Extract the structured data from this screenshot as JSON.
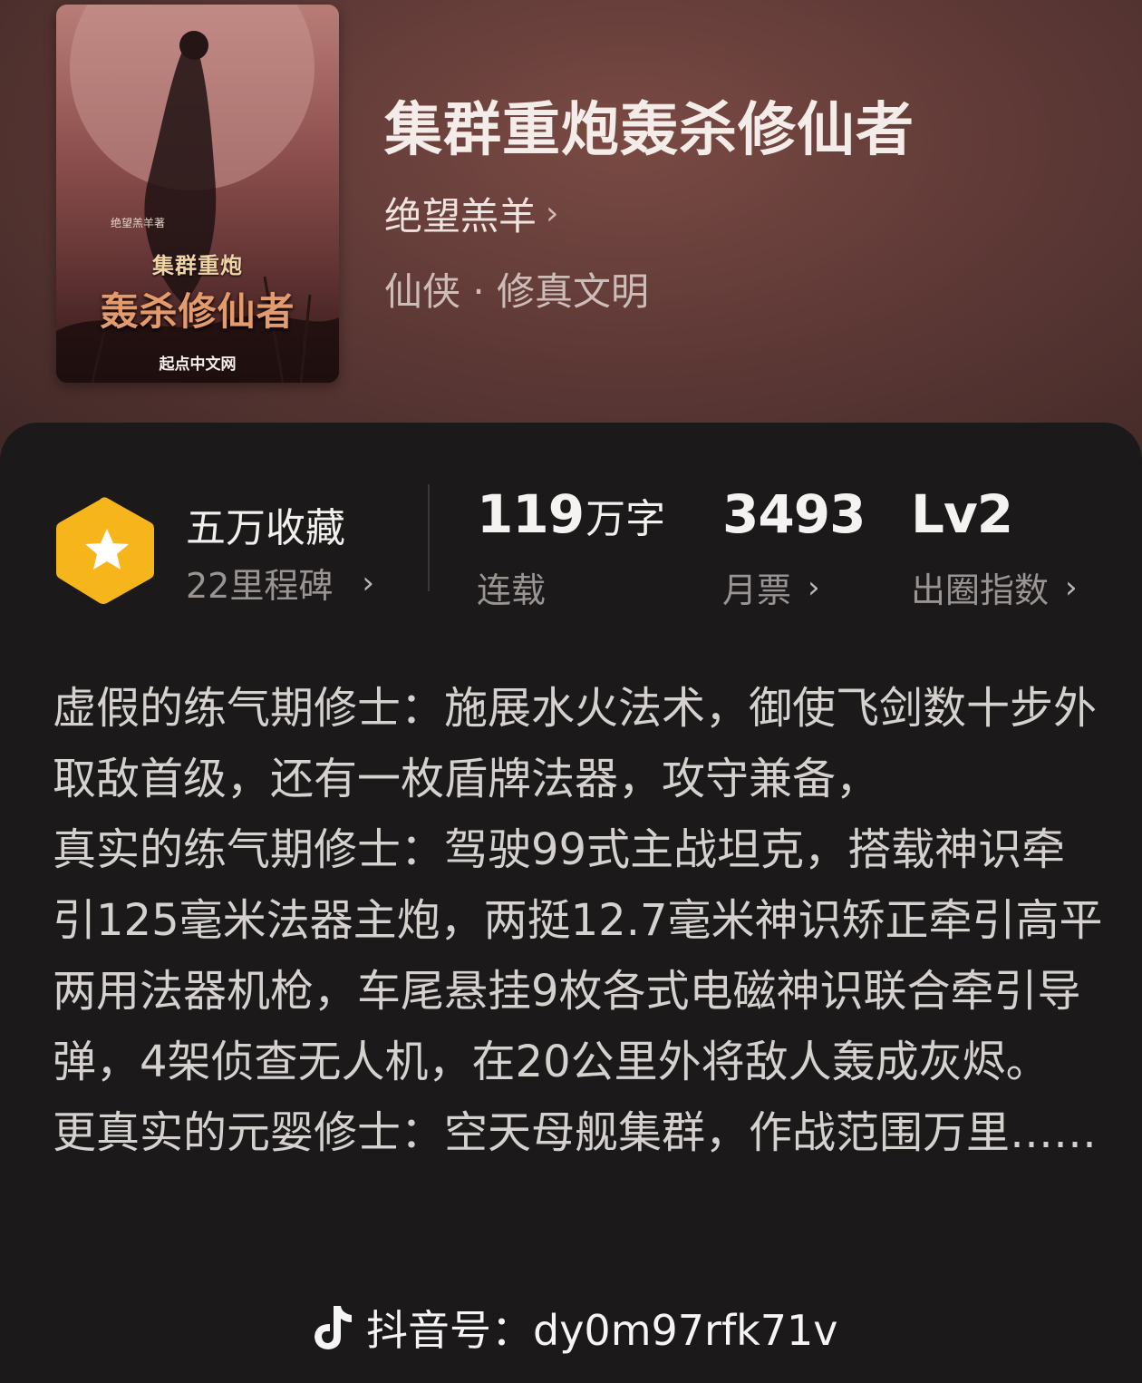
{
  "book": {
    "title": "集群重炮轰杀修仙者",
    "author": "绝望羔羊",
    "genre": "仙侠 · 修真文明"
  },
  "cover": {
    "author_tag": "绝望羔羊著",
    "title_line1": "集群重炮",
    "title_line2": "轰杀修仙者",
    "publisher": "起点中文网"
  },
  "stats": {
    "collection": {
      "title": "五万收藏",
      "subtitle": "22里程碑"
    },
    "words": {
      "value": "119",
      "unit": "万字",
      "label": "连载"
    },
    "tickets": {
      "value": "3493",
      "label": "月票"
    },
    "level": {
      "value": "Lv2",
      "label": "出圈指数"
    }
  },
  "description": [
    "虚假的练气期修士：施展水火法术，御使飞剑数十步外取敌首级，还有一枚盾牌法器，攻守兼备，",
    "真实的练气期修士：驾驶99式主战坦克，搭载神识牵引125毫米法器主炮，两挺12.7毫米神识矫正牵引高平两用法器机枪，车尾悬挂9枚各式电磁神识联合牵引导弹，4架侦查无人机，在20公里外将敌人轰成灰烬。",
    "更真实的元婴修士：空天母舰集群，作战范围万里……"
  ],
  "watermark": {
    "text": "抖音号：dy0m97rfk71v"
  },
  "colors": {
    "badge": "#f6b51a",
    "sheet_bg": "#1b1919",
    "hero_bg": "#5e3936"
  },
  "icons": {
    "chevron": "›",
    "badge": "star-hexagon-icon",
    "watermark": "tiktok-note-icon"
  }
}
